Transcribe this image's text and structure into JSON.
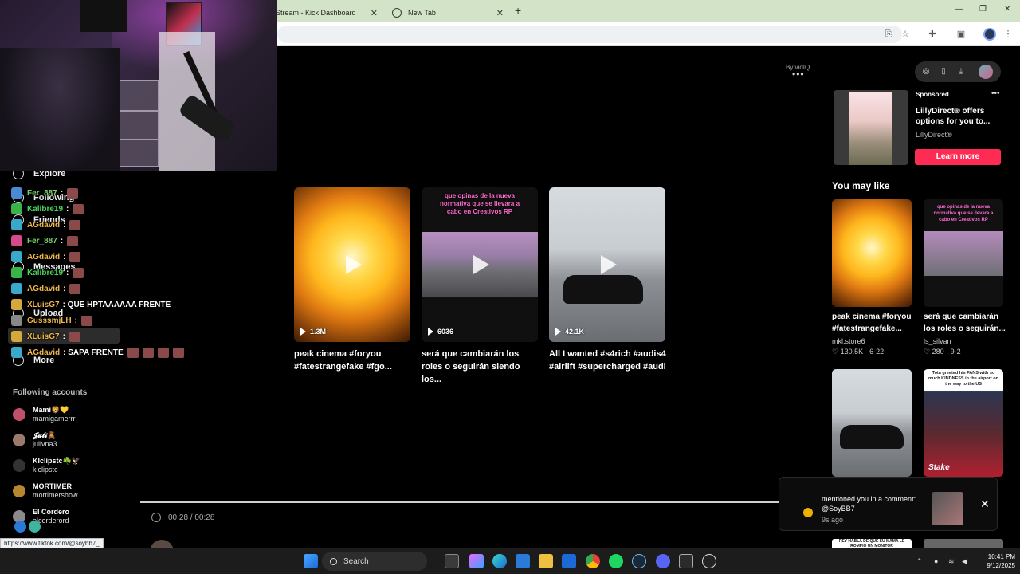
{
  "browser": {
    "tabs": [
      {
        "label": "Stream - Kick Dashboard"
      },
      {
        "label": "New Tab"
      }
    ],
    "new_tab_symbol": "+",
    "close_symbol": "✕",
    "window_controls": [
      "—",
      "❐",
      "✕"
    ]
  },
  "sidebar": {
    "nav": [
      {
        "label": "Explore",
        "icon": "compass-icon"
      },
      {
        "label": "Following",
        "icon": "following-icon"
      },
      {
        "label": "Friends",
        "icon": "friends-icon"
      },
      {
        "label": "Messages",
        "icon": "messages-icon"
      },
      {
        "label": "Upload",
        "icon": "upload-icon"
      },
      {
        "label": "More",
        "icon": "more-icon"
      }
    ],
    "following_title": "Following accounts",
    "accounts": [
      {
        "name": "Mami🦁💛",
        "handle": "mamigamerrr",
        "color": "#c0506a"
      },
      {
        "name": "𝓙𝓾𝓵𝓲🧸",
        "handle": "julivna3",
        "color": "#9a7a6a"
      },
      {
        "name": "Klclipstc☘️🦅",
        "handle": "klclipstc",
        "color": "#333333"
      },
      {
        "name": "MORTIMER",
        "handle": "mortimershow",
        "color": "#b8862e"
      },
      {
        "name": "El Cordero",
        "handle": "elcorderord",
        "color": "#8a8a8a"
      }
    ]
  },
  "chat": [
    {
      "user": "Fer_887",
      "color": "#7ad46a",
      "msg": ":",
      "emotes": 1,
      "badge": "#4a8ad4"
    },
    {
      "user": "Kalibre19",
      "color": "#46d45a",
      "msg": ":",
      "emotes": 1,
      "badge": "#3ab44a"
    },
    {
      "user": "AGdavid",
      "color": "#f0b84a",
      "msg": ":",
      "emotes": 1,
      "badge": "#3aa8c8"
    },
    {
      "user": "Fer_887",
      "color": "#7ad46a",
      "msg": ":",
      "emotes": 1,
      "badge": "#d44a8a"
    },
    {
      "user": "AGdavid",
      "color": "#f0b84a",
      "msg": ":",
      "emotes": 1,
      "badge": "#3aa8c8"
    },
    {
      "user": "Kalibre19",
      "color": "#46d45a",
      "msg": ":",
      "emotes": 1,
      "badge": "#3ab44a"
    },
    {
      "user": "AGdavid",
      "color": "#f0b84a",
      "msg": ":",
      "emotes": 1,
      "badge": "#3aa8c8"
    },
    {
      "user": "XLuisG7",
      "color": "#f0b84a",
      "msg": ": QUE HPTAAAAAA FRENTE",
      "emotes": 0,
      "badge": "#d4a83a"
    },
    {
      "user": "GusssmjLH",
      "color": "#f0b84a",
      "msg": ":",
      "emotes": 1,
      "badge": "#888888"
    },
    {
      "user": "XLuisG7",
      "color": "#f0b84a",
      "msg": ":",
      "emotes": 1,
      "badge": "#d4a83a"
    },
    {
      "user": "AGdavid",
      "color": "#f0b84a",
      "msg": ": SAPA FRENTE",
      "emotes": 4,
      "badge": "#3aa8c8"
    }
  ],
  "main": {
    "by_vidiq": "By vidIQ",
    "videos": [
      {
        "views": "1.3M",
        "title": "peak cinema #foryou #fatestrangefake #fgo..."
      },
      {
        "views": "6036",
        "title": "será que cambiarán los roles o seguirán siendo los...",
        "overlay": "que opinas de la nueva normativa que se llevara a cabo en Creativos RP"
      },
      {
        "views": "42.1K",
        "title": "All I wanted #s4rich #audis4 #airlift #supercharged #audi"
      }
    ],
    "player": {
      "time": "00:28 / 00:28",
      "progress": 1.0,
      "creator": "soybb7"
    }
  },
  "right": {
    "ad": {
      "label": "Sponsored",
      "title": "LillyDirect® offers options for you to...",
      "brand": "LillyDirect®",
      "cta": "Learn more"
    },
    "you_may_like": "You may like",
    "recs": [
      {
        "title": "peak cinema #foryou #fatestrangefake...",
        "user": "mkl.store6",
        "stats": "♡ 130.5K · 6-22"
      },
      {
        "title": "será que cambiarán los roles o seguirán...",
        "user": "ls_silvan",
        "stats": "♡ 280 · 9-2",
        "overlay": "que opinas de la nueva normativa que se llevara a cabo en Creativos RP"
      },
      {
        "overlay": ""
      },
      {
        "overlay": "Tota greeted his FANS with so much KINDNESS in the airport on the way to the US",
        "brand": "Stake"
      }
    ],
    "bottom_caption": "REY HABLA DE QUE SU MAMA LE ROMPIO UN MONITOR"
  },
  "toast": {
    "message": "mentioned you in a comment: @SoyBB7",
    "time": "9s ago"
  },
  "status_url": "https://www.tiktok.com/@soybb7_",
  "taskbar": {
    "search_label": "Search",
    "time": "10:41 PM",
    "date": "9/12/2025"
  }
}
